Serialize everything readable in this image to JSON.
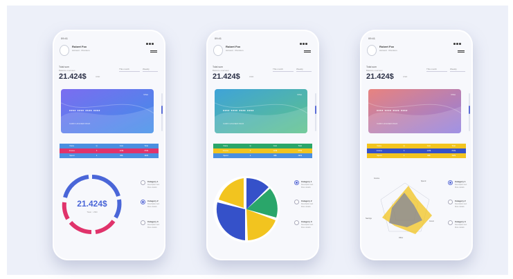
{
  "phones": [
    {
      "status_time": "09:41",
      "user": {
        "name": "Robert Fox",
        "subtitle": "Account · Premium"
      },
      "total": {
        "label": "Total sum",
        "sub": "Balance overview",
        "value": "21.424$",
        "unit": "USD"
      },
      "dropdowns": [
        "This month",
        "Weekly"
      ],
      "card": {
        "chip": "VISA",
        "number": "**** **** **** ****",
        "foot": "CARD HOLDER  09/24"
      },
      "table": [
        [
          "Name",
          "Q",
          "Cost",
          "Total"
        ],
        [
          "Income",
          "3",
          "124$",
          "372$"
        ],
        [
          "Spend",
          "2",
          "96$",
          "192$"
        ]
      ],
      "legend": [
        {
          "title": "Category 1",
          "l1": "Description text",
          "l2": "More details"
        },
        {
          "title": "Category 2",
          "l1": "Description text",
          "l2": "More details"
        },
        {
          "title": "Category 3",
          "l1": "Description text",
          "l2": "More details"
        }
      ],
      "donut": {
        "value": "21.424$",
        "sub": "Total · USD"
      }
    },
    {
      "status_time": "09:41",
      "user": {
        "name": "Robert Fox",
        "subtitle": "Account · Premium"
      },
      "total": {
        "label": "Total sum",
        "sub": "Balance overview",
        "value": "21.424$",
        "unit": "USD"
      },
      "dropdowns": [
        "This month",
        "Weekly"
      ],
      "card": {
        "chip": "VISA",
        "number": "**** **** **** ****",
        "foot": "CARD HOLDER  09/24"
      },
      "table": [
        [
          "Name",
          "Q",
          "Cost",
          "Total"
        ],
        [
          "Income",
          "3",
          "124$",
          "372$"
        ],
        [
          "Spend",
          "2",
          "96$",
          "192$"
        ]
      ],
      "legend": [
        {
          "title": "Category 1",
          "l1": "Description text",
          "l2": "More details"
        },
        {
          "title": "Category 2",
          "l1": "Description text",
          "l2": "More details"
        },
        {
          "title": "Category 3",
          "l1": "Description text",
          "l2": "More details"
        }
      ]
    },
    {
      "status_time": "09:41",
      "user": {
        "name": "Robert Fox",
        "subtitle": "Account · Premium"
      },
      "total": {
        "label": "Total sum",
        "sub": "Balance overview",
        "value": "21.424$",
        "unit": "USD"
      },
      "dropdowns": [
        "This month",
        "Weekly"
      ],
      "card": {
        "chip": "VISA",
        "number": "**** **** **** ****",
        "foot": "CARD HOLDER  09/24"
      },
      "table": [
        [
          "Name",
          "Q",
          "Cost",
          "Total"
        ],
        [
          "Income",
          "3",
          "124$",
          "372$"
        ],
        [
          "Spend",
          "2",
          "96$",
          "192$"
        ]
      ],
      "legend": [
        {
          "title": "Category 1",
          "l1": "Description text",
          "l2": "More details"
        },
        {
          "title": "Category 2",
          "l1": "Description text",
          "l2": "More details"
        },
        {
          "title": "Category 3",
          "l1": "Description text",
          "l2": "More details"
        }
      ],
      "radar_axes": [
        "Income",
        "Spend",
        "Savings",
        "Invest",
        "Other"
      ]
    }
  ],
  "colors": {
    "blue": "#4a66d8",
    "pink": "#e0336b",
    "green": "#2aa66a",
    "yellow": "#f2c41f",
    "light_blue": "#4a8fe0",
    "navy": "#3551c9"
  }
}
